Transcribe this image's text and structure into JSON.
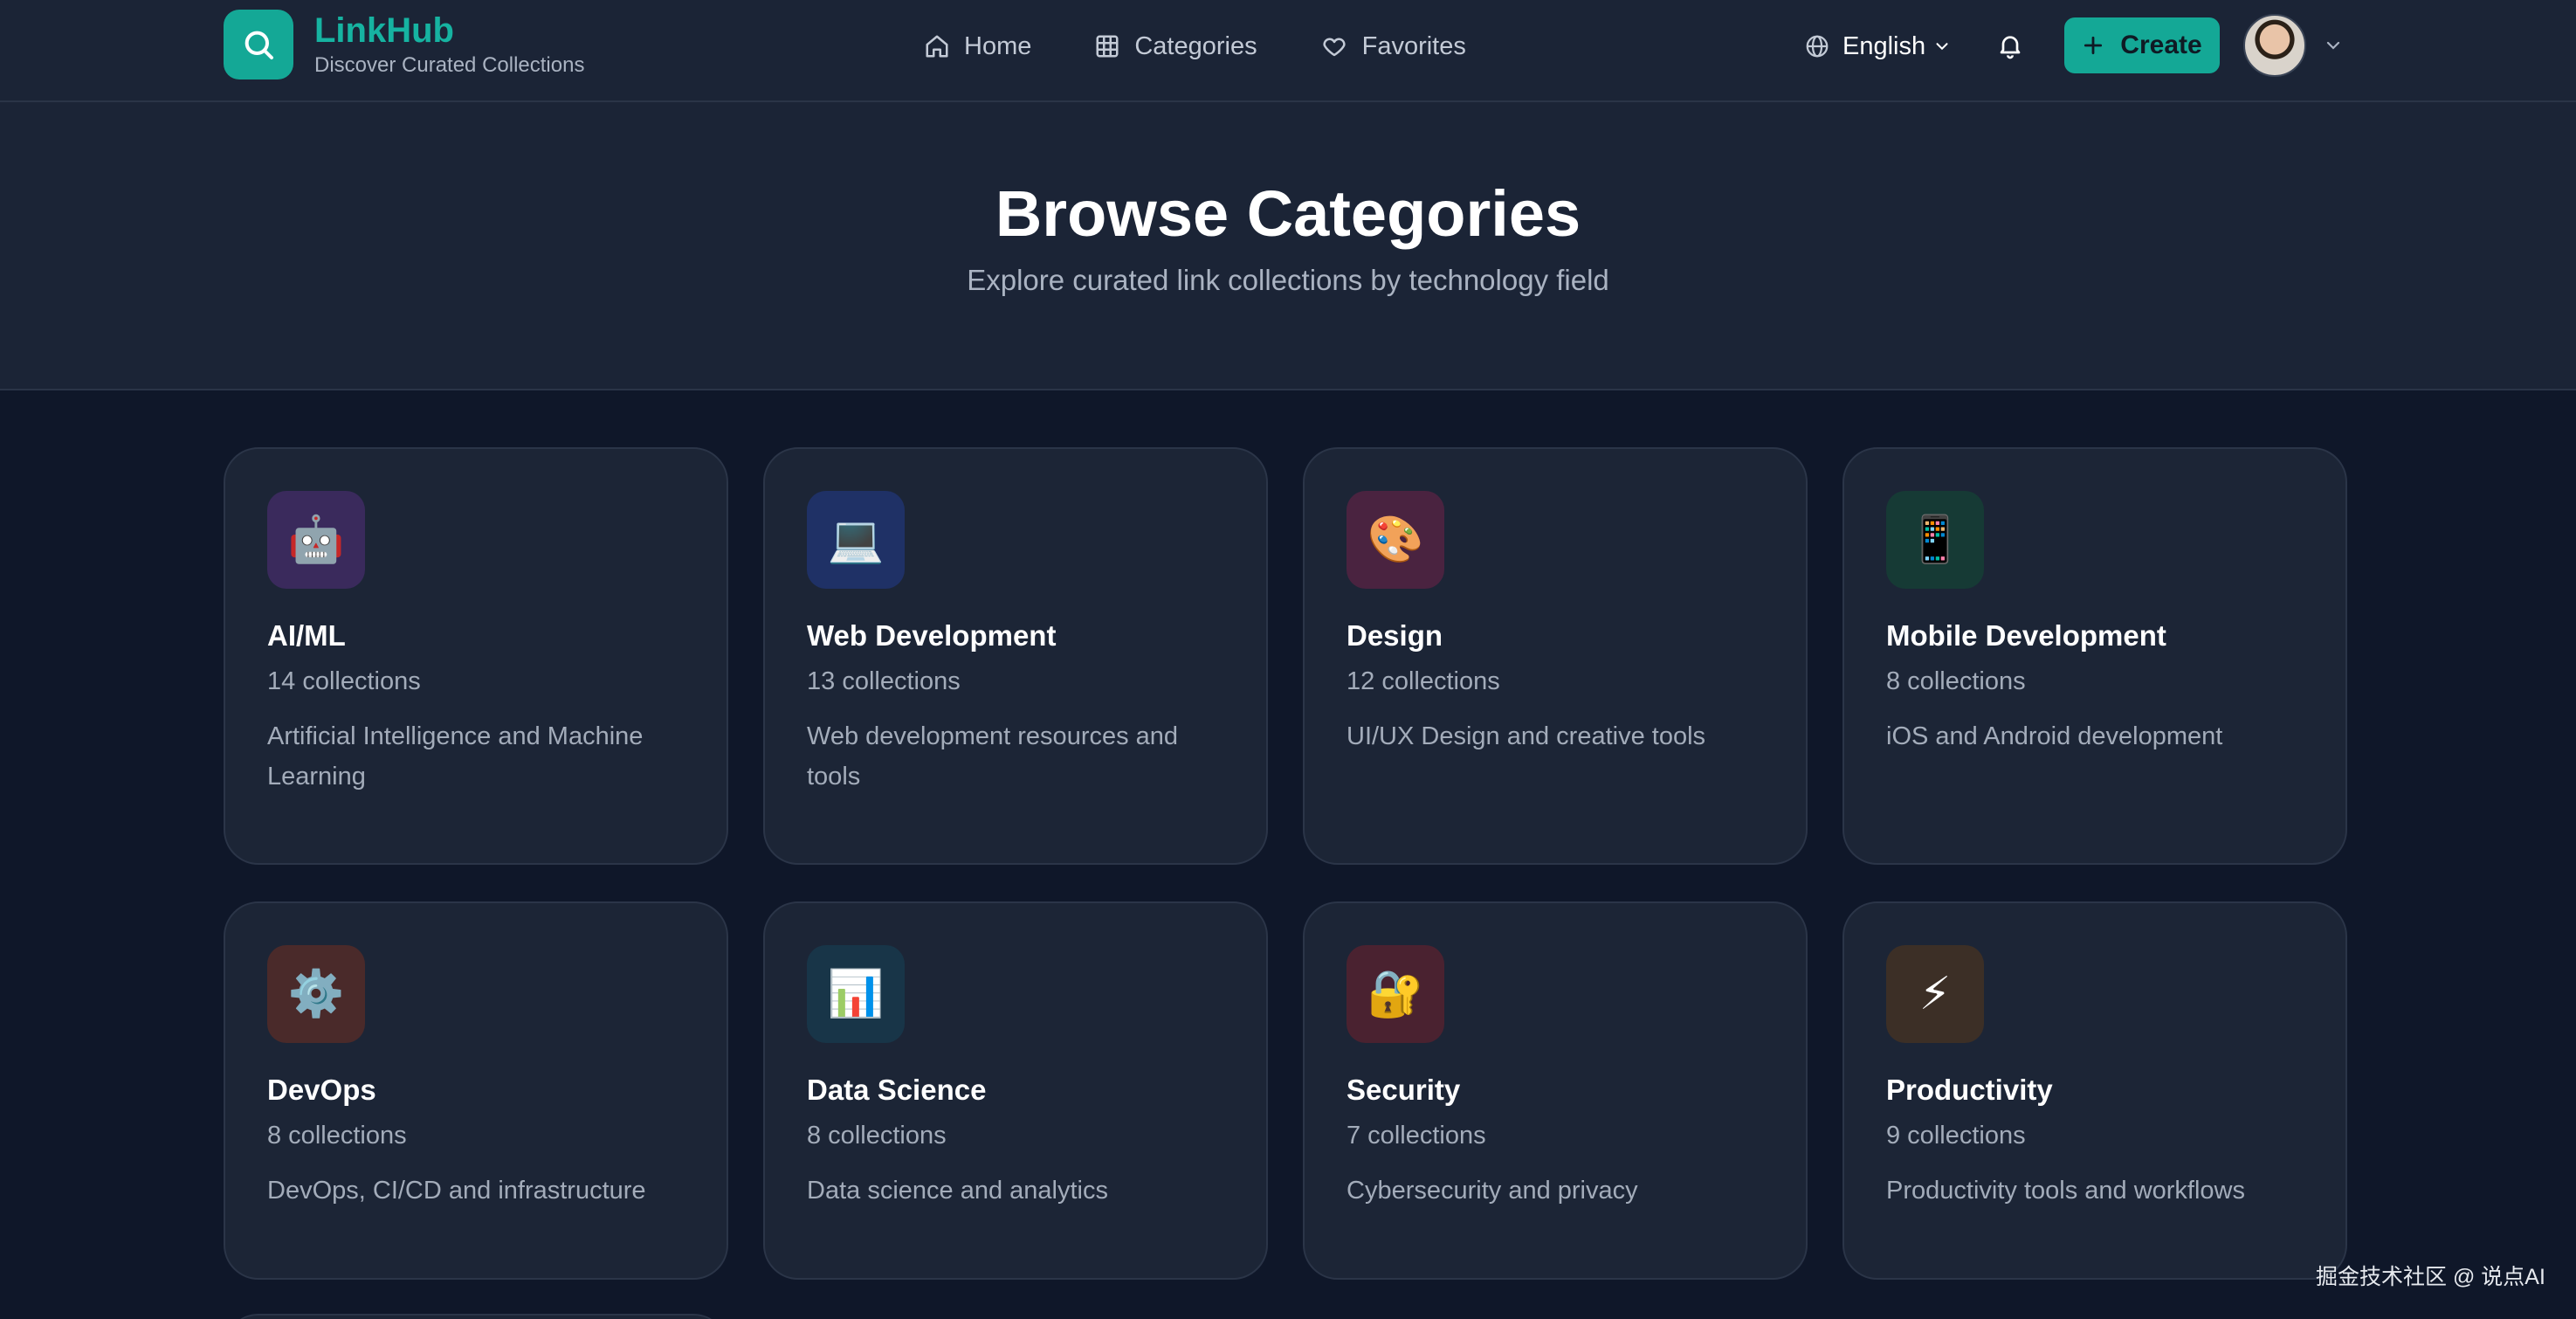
{
  "brand": {
    "name": "LinkHub",
    "tagline": "Discover Curated Collections"
  },
  "nav": {
    "home": "Home",
    "categories": "Categories",
    "favorites": "Favorites"
  },
  "header": {
    "language": "English",
    "create_label": "Create"
  },
  "hero": {
    "title": "Browse Categories",
    "subtitle": "Explore curated link collections by technology field"
  },
  "categories": [
    {
      "icon": "🤖",
      "icon_name": "robot-icon",
      "color": "#3a2a5c",
      "title": "AI/ML",
      "count": "14 collections",
      "desc": "Artificial Intelligence and Machine Learning"
    },
    {
      "icon": "💻",
      "icon_name": "laptop-icon",
      "color": "#1f3166",
      "title": "Web Development",
      "count": "13 collections",
      "desc": "Web development resources and tools"
    },
    {
      "icon": "🎨",
      "icon_name": "palette-icon",
      "color": "#4a2340",
      "title": "Design",
      "count": "12 collections",
      "desc": "UI/UX Design and creative tools"
    },
    {
      "icon": "📱",
      "icon_name": "mobile-phone-icon",
      "color": "#163a35",
      "title": "Mobile Development",
      "count": "8 collections",
      "desc": "iOS and Android development"
    },
    {
      "icon": "⚙️",
      "icon_name": "gear-icon",
      "color": "#4a2a2a",
      "title": "DevOps",
      "count": "8 collections",
      "desc": "DevOps, CI/CD and infrastructure"
    },
    {
      "icon": "📊",
      "icon_name": "bar-chart-icon",
      "color": "#183548",
      "title": "Data Science",
      "count": "8 collections",
      "desc": "Data science and analytics"
    },
    {
      "icon": "🔐",
      "icon_name": "lock-key-icon",
      "color": "#4a2230",
      "title": "Security",
      "count": "7 collections",
      "desc": "Cybersecurity and privacy"
    },
    {
      "icon": "⚡",
      "icon_name": "lightning-icon",
      "color": "#3c2f26",
      "title": "Productivity",
      "count": "9 collections",
      "desc": "Productivity tools and workflows"
    }
  ],
  "watermark": "掘金技术社区 @ 说点AI"
}
